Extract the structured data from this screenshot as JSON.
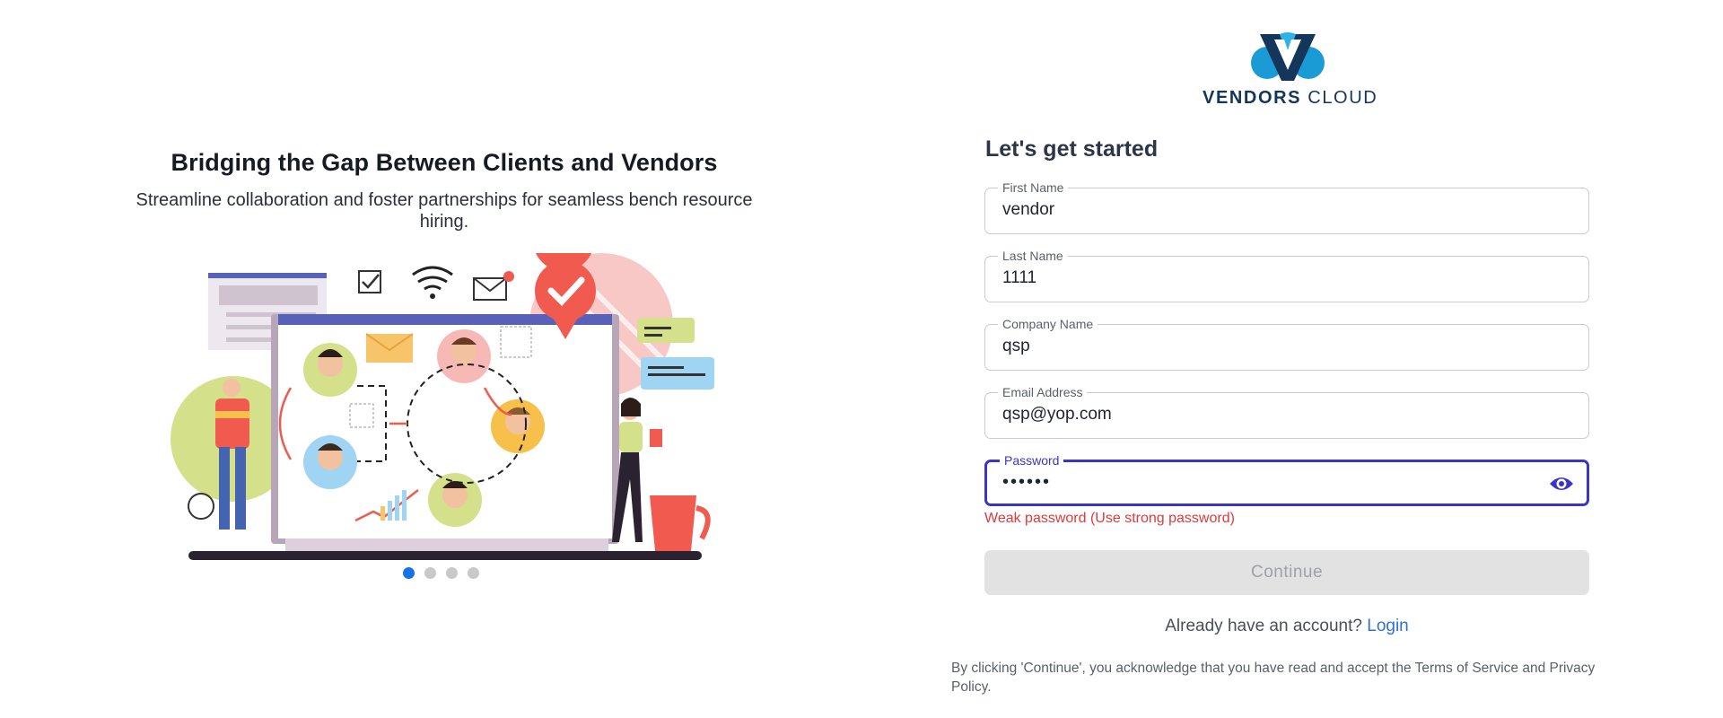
{
  "hero": {
    "title": "Bridging the Gap Between Clients and Vendors",
    "subtitle": "Streamline collaboration and foster partnerships for seamless bench resource hiring."
  },
  "carousel": {
    "slides": 4,
    "active_index": 0
  },
  "brand": {
    "bold": "VENDORS",
    "light": "CLOUD",
    "color": "#14365a",
    "accent": "#1b9bd6"
  },
  "form": {
    "title": "Let's get started",
    "fields": [
      {
        "label": "First Name",
        "value": "vendor"
      },
      {
        "label": "Last Name",
        "value": "1111"
      },
      {
        "label": "Company Name",
        "value": "qsp"
      },
      {
        "label": "Email Address",
        "value": "qsp@yop.com"
      },
      {
        "label": "Password",
        "value": "••••••",
        "focused": true
      }
    ],
    "password_error": "Weak password (Use strong password)",
    "continue_label": "Continue",
    "login_prompt": "Already have an account?",
    "login_link": "Login",
    "legal": "By clicking 'Continue', you acknowledge that you have read and accept the Terms of Service and Privacy Policy."
  },
  "colors": {
    "focus": "#3a34c9",
    "error": "#e0393b",
    "link": "#2f6fdd",
    "dot_active": "#1673e6"
  }
}
